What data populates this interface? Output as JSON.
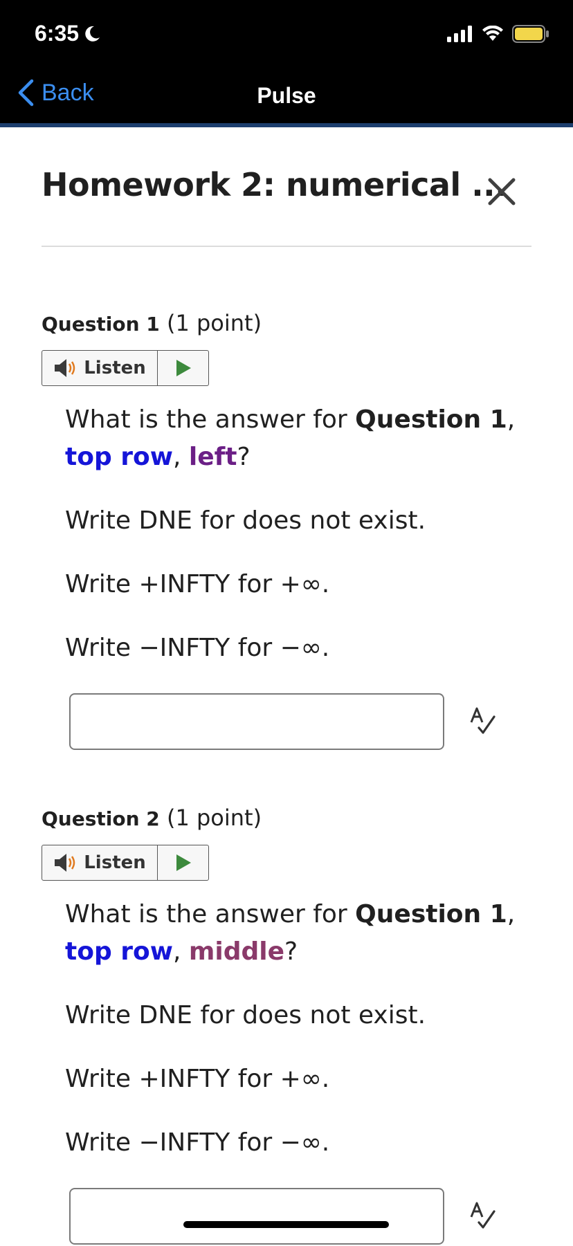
{
  "status": {
    "time": "6:35"
  },
  "nav": {
    "back_label": "Back",
    "title": "Pulse"
  },
  "page": {
    "title": "Homework 2: numerical ..."
  },
  "questions": [
    {
      "label": "Question 1",
      "points": "(1 point)",
      "listen_label": "Listen",
      "prompt_prefix": "What is the answer for ",
      "prompt_bold": "Question 1",
      "prompt_sep": ", ",
      "prompt_row": "top row",
      "prompt_sep2": ", ",
      "prompt_col": "left",
      "prompt_end": "?",
      "hint_dne": "Write DNE for does not exist.",
      "hint_pos": "Write +INFTY for +∞.",
      "hint_neg": "Write −INFTY for −∞.",
      "answer_value": ""
    },
    {
      "label": "Question 2",
      "points": "(1 point)",
      "listen_label": "Listen",
      "prompt_prefix": "What is the answer for ",
      "prompt_bold": "Question 1",
      "prompt_sep": ", ",
      "prompt_row": "top row",
      "prompt_sep2": ", ",
      "prompt_col": "middle",
      "prompt_end": "?",
      "hint_dne": "Write DNE for does not exist.",
      "hint_pos": "Write +INFTY for +∞.",
      "hint_neg": "Write −INFTY for −∞.",
      "answer_value": ""
    }
  ],
  "colors": {
    "nav_bar": "#000000",
    "nav_accent": "#1d3f6e",
    "link_blue": "#3b8ef0",
    "keyword_blue": "#1515d8"
  }
}
